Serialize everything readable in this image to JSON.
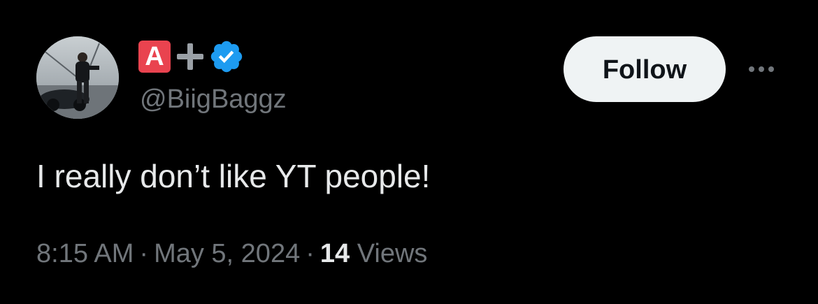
{
  "author": {
    "display_name_icons": [
      "letter-a-badge-icon",
      "plus-icon",
      "verified-badge-icon"
    ],
    "display_name_letter": "A",
    "handle": "@BiigBaggz",
    "verified_color": "#1d9bf0"
  },
  "actions": {
    "follow_label": "Follow",
    "more_icon": "more-horizontal-icon"
  },
  "tweet": {
    "text": "I really don’t like YT people!"
  },
  "meta": {
    "time": "8:15 AM",
    "separator": "·",
    "date": "May 5, 2024",
    "views_count": "14",
    "views_label": "Views"
  },
  "colors": {
    "background": "#000000",
    "text_primary": "#e7e9ea",
    "text_secondary": "#71767b",
    "follow_button_bg": "#eff3f4",
    "letter_badge_bg": "#e9434f"
  }
}
